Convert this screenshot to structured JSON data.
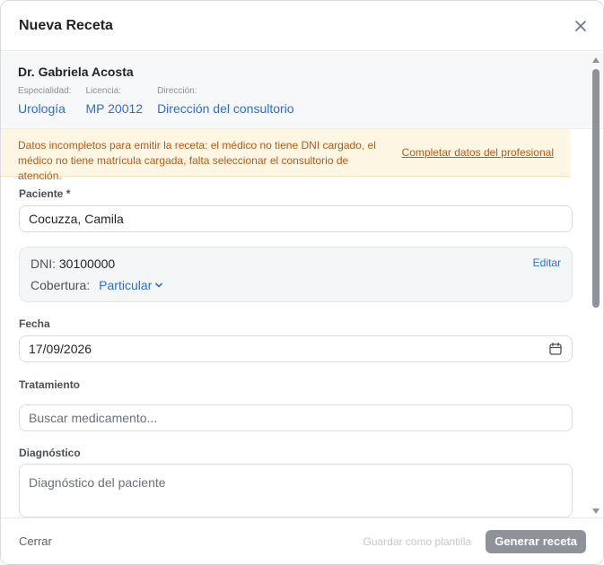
{
  "modal": {
    "title": "Nueva Receta"
  },
  "doctor": {
    "name": "Dr. Gabriela Acosta",
    "specialty_label": "Especialidad:",
    "specialty_value": "Urología",
    "license_label": "Licencia:",
    "license_value": "MP 20012",
    "address_label": "Dirección:",
    "address_value": "Dirección del consultorio"
  },
  "warning": {
    "text": "Datos incompletos para emitir la receta: el médico no tiene DNI cargado, el médico no tiene matrícula cargada, falta seleccionar el consultorio de atención.",
    "link": "Completar datos del profesional"
  },
  "patient": {
    "label": "Paciente *",
    "value": "Cocuzza, Camila",
    "dni_label": "DNI:",
    "dni_value": "30100000",
    "edit_label": "Editar",
    "coverage_label": "Cobertura:",
    "coverage_value": "Particular"
  },
  "date": {
    "label": "Fecha",
    "value": "17/09/2026"
  },
  "treatment": {
    "label": "Tratamiento",
    "placeholder": "Buscar medicamento..."
  },
  "diagnosis": {
    "label": "Diagnóstico",
    "placeholder": "Diagnóstico del paciente"
  },
  "footer": {
    "close_label": "Cerrar",
    "template_label": "Guardar como plantilla",
    "generate_label": "Generar receta"
  },
  "icons": {
    "close": "close-icon",
    "calendar": "calendar-icon",
    "chevron": "chevron-down-icon"
  },
  "colors": {
    "accent": "#2a6fd6",
    "warning_text": "#b55a17",
    "warning_bg": "#fdf6e3",
    "disabled_button": "#8f9399"
  }
}
